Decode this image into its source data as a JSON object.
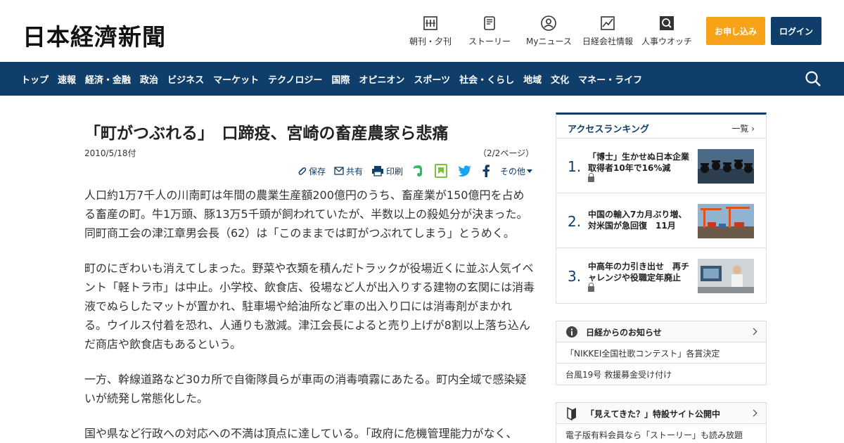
{
  "header": {
    "logo": "日本経濟新聞",
    "nav": [
      {
        "label": "朝刊・夕刊",
        "icon": "newspaper-icon"
      },
      {
        "label": "ストーリー",
        "icon": "phone-icon"
      },
      {
        "label": "Myニュース",
        "icon": "user-icon"
      },
      {
        "label": "日経会社情報",
        "icon": "chart-icon"
      },
      {
        "label": "人事ウオッチ",
        "icon": "magnifier-icon"
      }
    ],
    "subscribe_label": "お申し込み",
    "login_label": "ログイン"
  },
  "navbar": {
    "items": [
      "トップ",
      "速報",
      "経済・金融",
      "政治",
      "ビジネス",
      "マーケット",
      "テクノロジー",
      "国際",
      "オピニオン",
      "スポーツ",
      "社会・くらし",
      "地域",
      "文化",
      "マネー・ライフ"
    ]
  },
  "article": {
    "title": "「町がつぶれる」　口蹄疫、宮崎の畜産農家ら悲痛",
    "date": "2010/5/18付",
    "pages": "（2/2ページ）",
    "tools": {
      "save": "保存",
      "share": "共有",
      "print": "印刷",
      "more": "その他"
    },
    "paragraphs": [
      "人口約1万7千人の川南町は年間の農業生産額200億円のうち、畜産業が150億円を占める畜産の町。牛1万頭、豚13万5千頭が飼われていたが、半数以上の殺処分が決まった。同町商工会の津江章男会長（62）は「このままでは町がつぶれてしまう」とうめく。",
      "町のにぎわいも消えてしまった。野菜や衣類を積んだトラックが役場近くに並ぶ人気イベント「軽トラ市」は中止。小学校、飲食店、役場など人が出入りする建物の玄関には消毒液でぬらしたマットが置かれ、駐車場や給油所など車の出入り口には消毒剤がまかれる。ウイルス付着を恐れ、人通りも激減。津江会長によると売り上げが8割以上落ち込んだ商店や飲食店もあるという。",
      "一方、幹線道路など30カ所で自衛隊員らが車両の消毒噴霧にあたる。町内全域で感染疑いが続発し常態化した。",
      "国や県など行政への対応への不満は頂点に達している。「政府に危機管理能力がなく、"
    ]
  },
  "ranking": {
    "title": "アクセスランキング",
    "more": "一覧",
    "items": [
      {
        "num": "1.",
        "text": "「博士」生かせぬ日本企業　取得者10年で16%減",
        "locked": true
      },
      {
        "num": "2.",
        "text": "中国の輸入7カ月ぶり増、対米国が急回復　11月",
        "locked": false
      },
      {
        "num": "3.",
        "text": "中高年の力引き出せ　再チャレンジや役職定年廃止",
        "locked": true
      }
    ]
  },
  "notice": {
    "title": "日経からのお知らせ",
    "items": [
      "「NIKKEI全国社歌コンテスト」各賞決定",
      "台風19号 救援募金受け付け"
    ]
  },
  "feature": {
    "title": "「見えてきた？」特設サイト公開中",
    "text": "電子版有料会員なら「ストーリー」も読み放題"
  }
}
